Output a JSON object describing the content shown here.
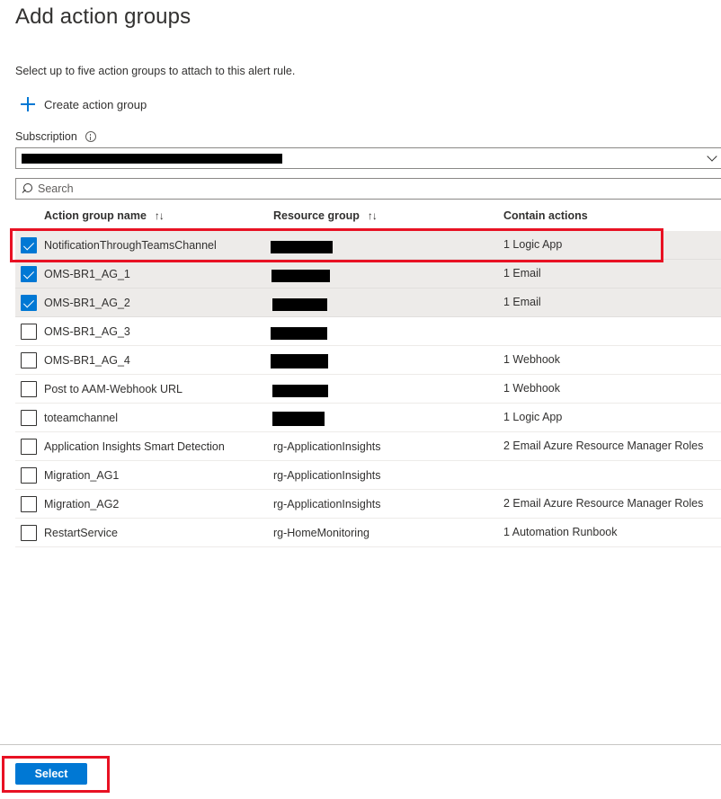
{
  "panel": {
    "title": "Add action groups",
    "description": "Select up to five action groups to attach to this alert rule.",
    "create_label": "Create action group"
  },
  "subscription": {
    "label": "Subscription",
    "value_redacted": true
  },
  "search": {
    "placeholder": "Search"
  },
  "table": {
    "columns": {
      "name": "Action group name",
      "resource_group": "Resource group",
      "actions": "Contain actions"
    },
    "rows": [
      {
        "name": "NotificationThroughTeamsChannel",
        "resource_group": "",
        "rg_redacted": true,
        "actions": "1 Logic App",
        "checked": true
      },
      {
        "name": "OMS-BR1_AG_1",
        "resource_group": "",
        "rg_redacted": true,
        "actions": "1 Email",
        "checked": true
      },
      {
        "name": "OMS-BR1_AG_2",
        "resource_group": "",
        "rg_redacted": true,
        "actions": "1 Email",
        "checked": true
      },
      {
        "name": "OMS-BR1_AG_3",
        "resource_group": "",
        "rg_redacted": true,
        "actions": "",
        "checked": false
      },
      {
        "name": "OMS-BR1_AG_4",
        "resource_group": "",
        "rg_redacted": true,
        "actions": "1 Webhook",
        "checked": false
      },
      {
        "name": "Post to AAM-Webhook URL",
        "resource_group": "",
        "rg_redacted": true,
        "actions": "1 Webhook",
        "checked": false
      },
      {
        "name": "toteamchannel",
        "resource_group": "",
        "rg_redacted": true,
        "actions": "1 Logic App",
        "checked": false
      },
      {
        "name": "Application Insights Smart Detection",
        "resource_group": "rg-ApplicationInsights",
        "rg_redacted": false,
        "actions": "2 Email Azure Resource Manager Roles",
        "checked": false
      },
      {
        "name": "Migration_AG1",
        "resource_group": "rg-ApplicationInsights",
        "rg_redacted": false,
        "actions": "",
        "checked": false
      },
      {
        "name": "Migration_AG2",
        "resource_group": "rg-ApplicationInsights",
        "rg_redacted": false,
        "actions": "2 Email Azure Resource Manager Roles",
        "checked": false
      },
      {
        "name": "RestartService",
        "resource_group": "rg-HomeMonitoring",
        "rg_redacted": false,
        "actions": "1 Automation Runbook",
        "checked": false
      }
    ]
  },
  "footer": {
    "select_label": "Select"
  },
  "colors": {
    "accent": "#0078d4",
    "highlight": "#e81123",
    "selected_row": "#edebe9"
  }
}
